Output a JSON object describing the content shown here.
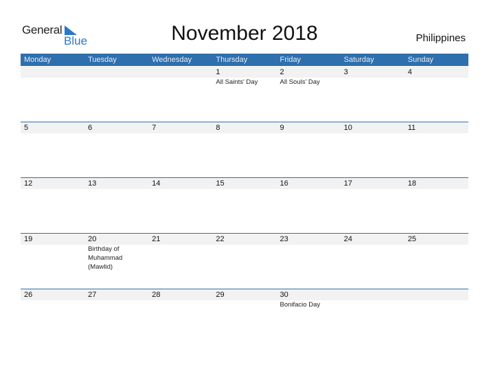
{
  "brand": {
    "line1": "General",
    "line2": "Blue",
    "accent": "#2a78c8"
  },
  "title": "November 2018",
  "country": "Philippines",
  "header_color": "#2e6fad",
  "weekdays": [
    "Monday",
    "Tuesday",
    "Wednesday",
    "Thursday",
    "Friday",
    "Saturday",
    "Sunday"
  ],
  "weeks": [
    {
      "days": [
        {
          "num": "",
          "events": ""
        },
        {
          "num": "",
          "events": ""
        },
        {
          "num": "",
          "events": ""
        },
        {
          "num": "1",
          "events": "All Saints' Day"
        },
        {
          "num": "2",
          "events": "All Souls' Day"
        },
        {
          "num": "3",
          "events": ""
        },
        {
          "num": "4",
          "events": ""
        }
      ]
    },
    {
      "days": [
        {
          "num": "5",
          "events": ""
        },
        {
          "num": "6",
          "events": ""
        },
        {
          "num": "7",
          "events": ""
        },
        {
          "num": "8",
          "events": ""
        },
        {
          "num": "9",
          "events": ""
        },
        {
          "num": "10",
          "events": ""
        },
        {
          "num": "11",
          "events": ""
        }
      ]
    },
    {
      "days": [
        {
          "num": "12",
          "events": ""
        },
        {
          "num": "13",
          "events": ""
        },
        {
          "num": "14",
          "events": ""
        },
        {
          "num": "15",
          "events": ""
        },
        {
          "num": "16",
          "events": ""
        },
        {
          "num": "17",
          "events": ""
        },
        {
          "num": "18",
          "events": ""
        }
      ]
    },
    {
      "days": [
        {
          "num": "19",
          "events": ""
        },
        {
          "num": "20",
          "events": "Birthday of Muhammad (Mawlid)"
        },
        {
          "num": "21",
          "events": ""
        },
        {
          "num": "22",
          "events": ""
        },
        {
          "num": "23",
          "events": ""
        },
        {
          "num": "24",
          "events": ""
        },
        {
          "num": "25",
          "events": ""
        }
      ]
    },
    {
      "days": [
        {
          "num": "26",
          "events": ""
        },
        {
          "num": "27",
          "events": ""
        },
        {
          "num": "28",
          "events": ""
        },
        {
          "num": "29",
          "events": ""
        },
        {
          "num": "30",
          "events": "Bonifacio Day"
        },
        {
          "num": "",
          "events": ""
        },
        {
          "num": "",
          "events": ""
        }
      ]
    }
  ]
}
